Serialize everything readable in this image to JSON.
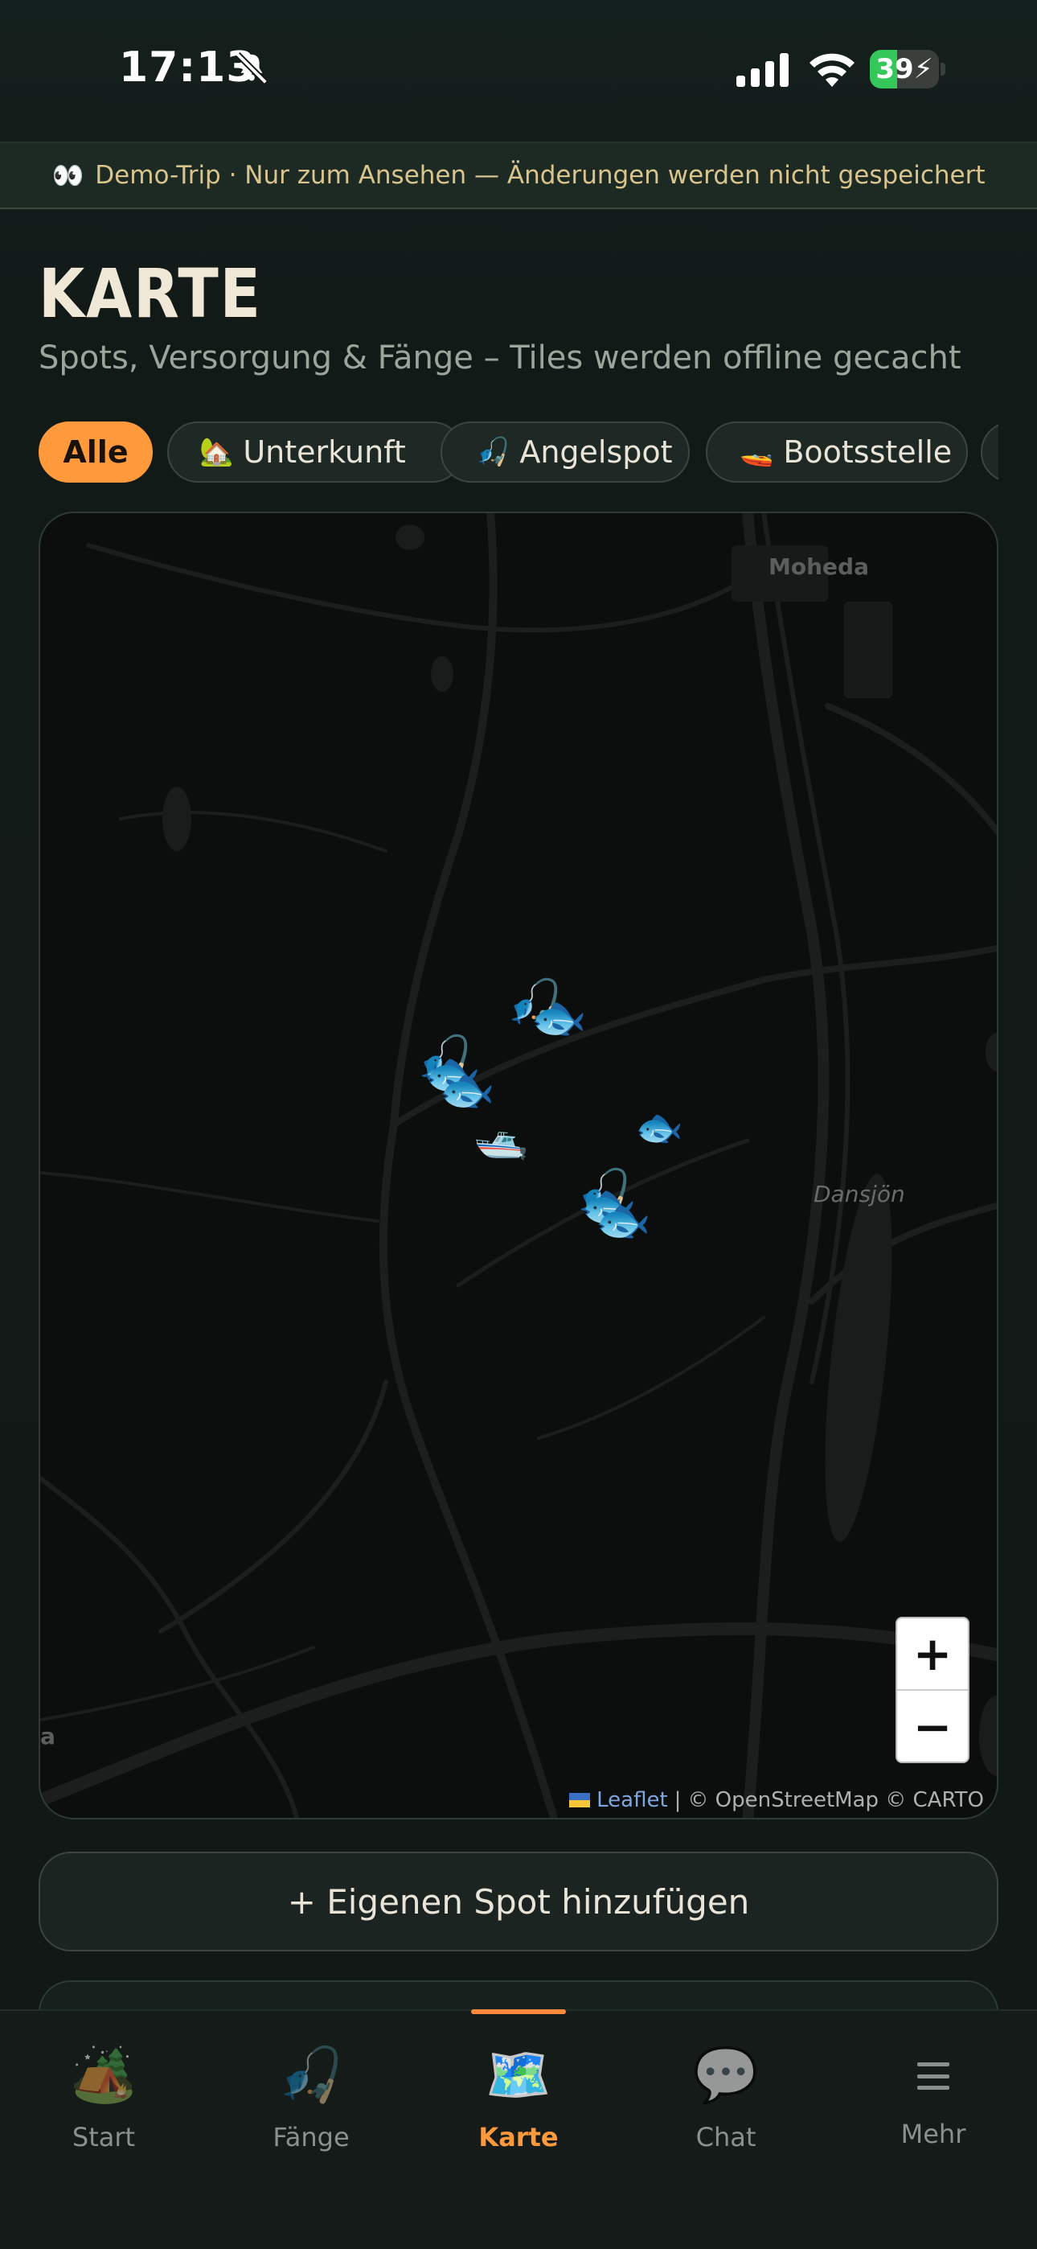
{
  "status_bar": {
    "time": "17:13",
    "battery": "39",
    "battery_level": 0.39
  },
  "banner": {
    "icon": "👀",
    "text": "Demo-Trip · Nur zum Ansehen — Änderungen werden nicht gespeichert"
  },
  "header": {
    "title": "KARTE",
    "subtitle": "Spots, Versorgung & Fänge – Tiles werden offline gecacht"
  },
  "filters": [
    {
      "label": "Alle",
      "icon": ""
    },
    {
      "label": "Unterkunft",
      "icon": "🏡"
    },
    {
      "label": "Angelspot",
      "icon": "🎣"
    },
    {
      "label": "Bootsstelle",
      "icon": "🚤"
    }
  ],
  "map": {
    "labels": {
      "town": "Moheda",
      "lake": "Dansjön",
      "edge": "a"
    },
    "markers": {
      "fishing_rod": "🎣",
      "fish": "🐟",
      "boat": "🛥️"
    },
    "zoom_in": "+",
    "zoom_out": "−",
    "attribution": {
      "leaflet": "Leaflet",
      "separator": "|",
      "rest": "© OpenStreetMap © CARTO"
    }
  },
  "add_spot": {
    "label": "+ Eigenen Spot hinzufügen"
  },
  "tabs": [
    {
      "label": "Start",
      "icon": "🏕️"
    },
    {
      "label": "Fänge",
      "icon": "🎣"
    },
    {
      "label": "Karte",
      "icon": "🗺️"
    },
    {
      "label": "Chat",
      "icon": "💬"
    },
    {
      "label": "Mehr",
      "icon": "hamburger-icon"
    }
  ],
  "colors": {
    "accent": "#ff9a3c",
    "background": "#121a18",
    "banner_text": "#d9c48e"
  }
}
